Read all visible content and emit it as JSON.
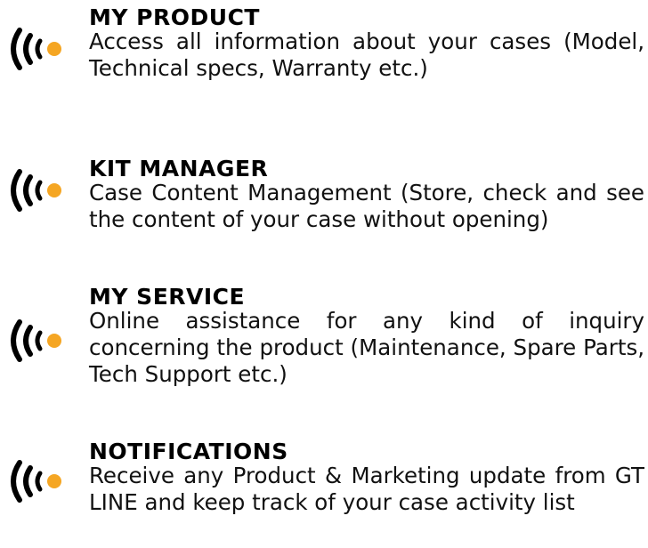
{
  "colors": {
    "accent": "#F5A623",
    "text": "#000000",
    "background": "#FFFFFF"
  },
  "features": [
    {
      "icon": "wireless-signal-icon",
      "title": "MY PRODUCT",
      "description": "Access all information about your cases (Model, Technical specs, Warranty etc.)"
    },
    {
      "icon": "wireless-signal-icon",
      "title": "KIT MANAGER",
      "description": "Case Content Management (Store, check and see the content of your case without opening)"
    },
    {
      "icon": "wireless-signal-icon",
      "title": "MY SERVICE",
      "description": "Online assistance for any kind of inquiry concerning the product (Maintenance, Spare Parts, Tech Support etc.)"
    },
    {
      "icon": "wireless-signal-icon",
      "title": "NOTIFICATIONS",
      "description": "Receive any Product & Marketing update from GT LINE and keep track of your case activity list"
    }
  ]
}
